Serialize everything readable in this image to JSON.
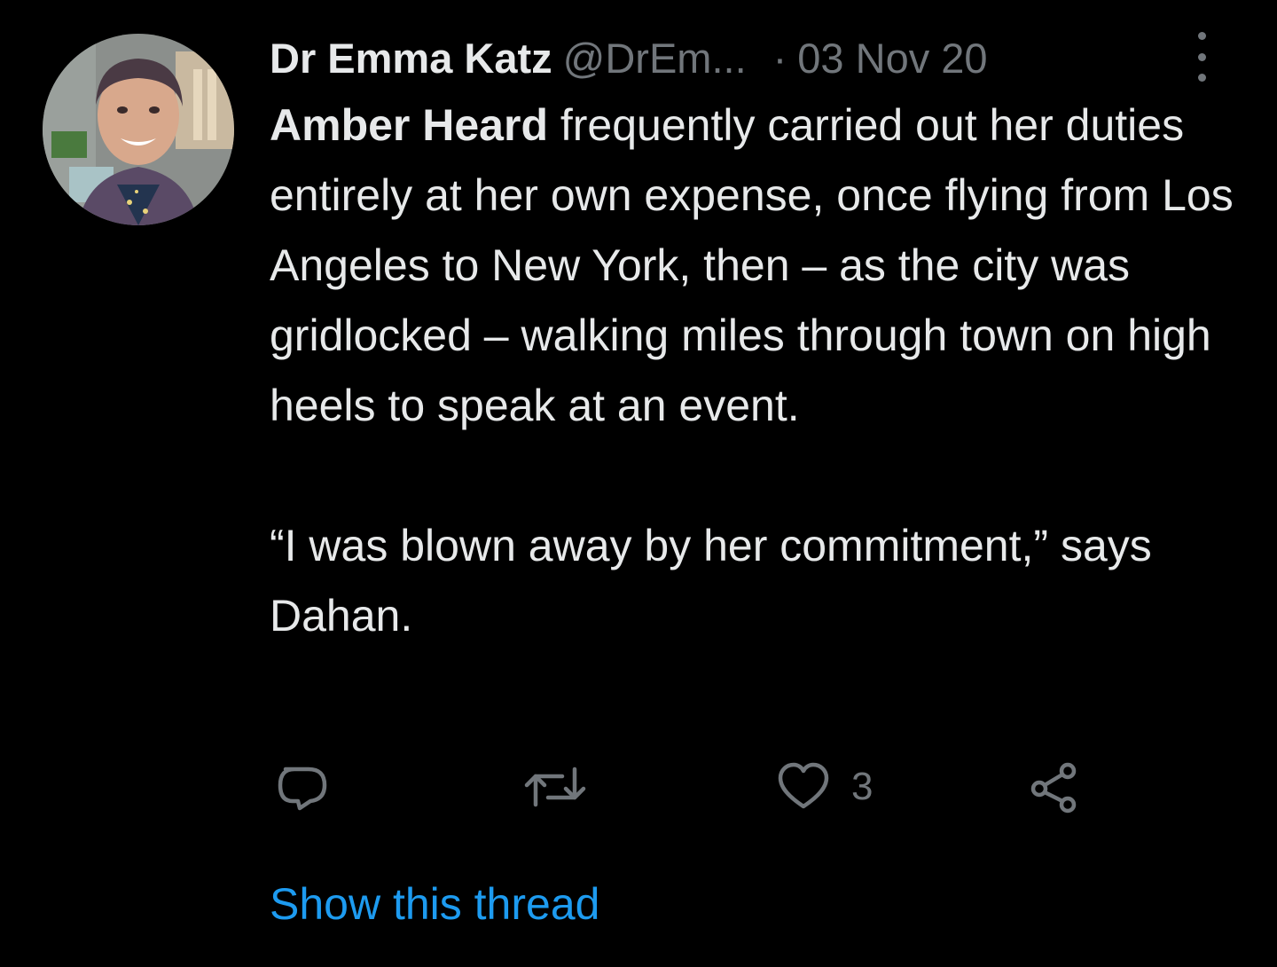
{
  "tweet": {
    "author": {
      "display_name": "Dr Emma Katz",
      "handle": "@DrEm...",
      "avatar_icon": "profile-photo-avatar"
    },
    "separator": "·",
    "date": "03 Nov 20",
    "body": {
      "mention": "Amber Heard",
      "paragraph1_rest": " frequently carried out her duties entirely at her own expense, once flying from Los Angeles to New York, then – as the city was gridlocked – walking miles through town on high heels to speak at an event.",
      "paragraph2": "“I was blown away by her commitment,” says Dahan."
    },
    "actions": {
      "reply_icon": "reply-icon",
      "retweet_icon": "retweet-icon",
      "like_icon": "heart-icon",
      "like_count": "3",
      "share_icon": "share-icon"
    },
    "show_thread": "Show this thread"
  },
  "colors": {
    "background": "#000000",
    "primary_text": "#e7e9ea",
    "secondary_text": "#71767b",
    "link": "#1d9bf0"
  }
}
